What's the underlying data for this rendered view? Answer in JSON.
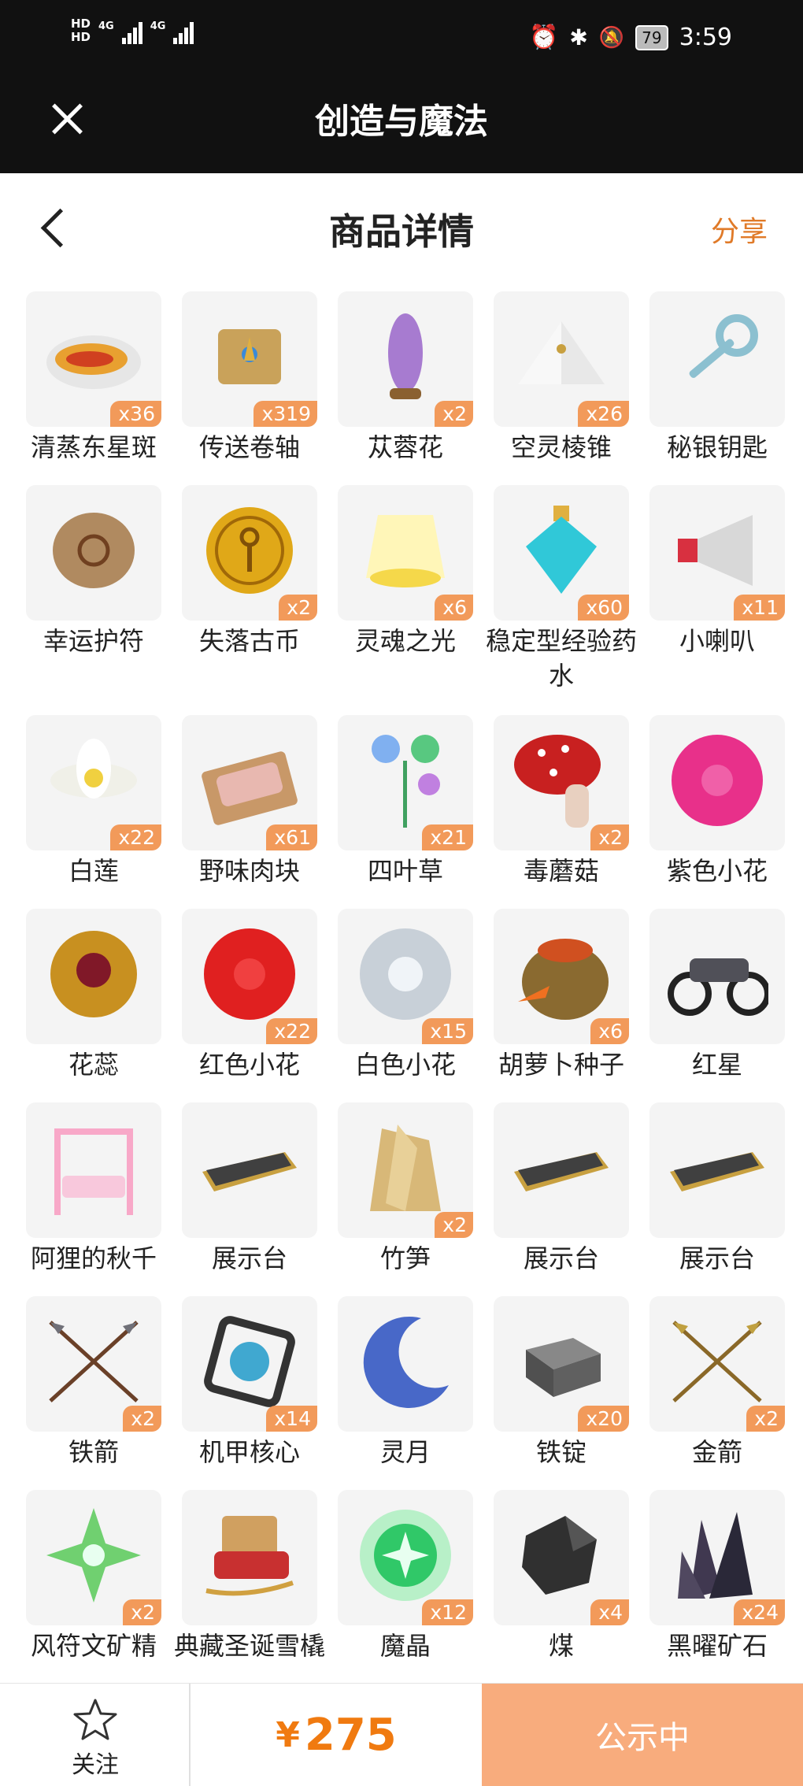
{
  "status_bar": {
    "hd1": "HD",
    "hd2": "HD",
    "net1": "4G",
    "net2": "4G",
    "battery": "79",
    "time": "3:59"
  },
  "app": {
    "title": "创造与魔法"
  },
  "header": {
    "title": "商品详情",
    "share_label": "分享"
  },
  "items": [
    {
      "name": "清蒸东星斑",
      "qty": "x36",
      "icon": "fish-dish-icon",
      "color": "#e8a030"
    },
    {
      "name": "传送卷轴",
      "qty": "x319",
      "icon": "scroll-icon",
      "color": "#c9a25a"
    },
    {
      "name": "苁蓉花",
      "qty": "x2",
      "icon": "cistanche-flower-icon",
      "color": "#a77bd0"
    },
    {
      "name": "空灵棱锥",
      "qty": "x26",
      "icon": "pyramid-icon",
      "color": "#e8e8e8"
    },
    {
      "name": "秘银钥匙",
      "qty": "",
      "icon": "key-icon",
      "color": "#8cc0d0"
    },
    {
      "name": "幸运护符",
      "qty": "",
      "icon": "amulet-icon",
      "color": "#b08a60"
    },
    {
      "name": "失落古币",
      "qty": "x2",
      "icon": "coin-icon",
      "color": "#e0a818"
    },
    {
      "name": "灵魂之光",
      "qty": "x6",
      "icon": "light-icon",
      "color": "#f5d84a"
    },
    {
      "name": "稳定型经验药水",
      "qty": "x60",
      "icon": "potion-icon",
      "color": "#30c8d8"
    },
    {
      "name": "小喇叭",
      "qty": "x11",
      "icon": "megaphone-icon",
      "color": "#d83040"
    },
    {
      "name": "白莲",
      "qty": "x22",
      "icon": "lotus-icon",
      "color": "#f0f0e8"
    },
    {
      "name": "野味肉块",
      "qty": "x61",
      "icon": "meat-icon",
      "color": "#b07858"
    },
    {
      "name": "四叶草",
      "qty": "x21",
      "icon": "clover-icon",
      "color": "#58c880"
    },
    {
      "name": "毒蘑菇",
      "qty": "x2",
      "icon": "mushroom-icon",
      "color": "#c82020"
    },
    {
      "name": "紫色小花",
      "qty": "",
      "icon": "purple-flower-icon",
      "color": "#e8308a"
    },
    {
      "name": "花蕊",
      "qty": "",
      "icon": "stamen-icon",
      "color": "#c89020"
    },
    {
      "name": "红色小花",
      "qty": "x22",
      "icon": "red-flower-icon",
      "color": "#e02020"
    },
    {
      "name": "白色小花",
      "qty": "x15",
      "icon": "white-flower-icon",
      "color": "#c8d0d8"
    },
    {
      "name": "胡萝卜种子",
      "qty": "x6",
      "icon": "seed-bag-icon",
      "color": "#8a6a30"
    },
    {
      "name": "红星",
      "qty": "",
      "icon": "motorcycle-icon",
      "color": "#505058"
    },
    {
      "name": "阿狸的秋千",
      "qty": "",
      "icon": "swing-icon",
      "color": "#f8a8c8"
    },
    {
      "name": "展示台",
      "qty": "",
      "icon": "display-stand-icon",
      "color": "#404040"
    },
    {
      "name": "竹笋",
      "qty": "x2",
      "icon": "bamboo-shoot-icon",
      "color": "#d8b878"
    },
    {
      "name": "展示台",
      "qty": "",
      "icon": "display-stand-icon",
      "color": "#404040"
    },
    {
      "name": "展示台",
      "qty": "",
      "icon": "display-stand-icon",
      "color": "#404040"
    },
    {
      "name": "铁箭",
      "qty": "x2",
      "icon": "iron-arrow-icon",
      "color": "#707078"
    },
    {
      "name": "机甲核心",
      "qty": "x14",
      "icon": "mech-core-icon",
      "color": "#40a8d0"
    },
    {
      "name": "灵月",
      "qty": "",
      "icon": "moon-icon",
      "color": "#4868c8"
    },
    {
      "name": "铁锭",
      "qty": "x20",
      "icon": "iron-ingot-icon",
      "color": "#606060"
    },
    {
      "name": "金箭",
      "qty": "x2",
      "icon": "gold-arrow-icon",
      "color": "#c0a040"
    },
    {
      "name": "风符文矿精",
      "qty": "x2",
      "icon": "wind-rune-icon",
      "color": "#70d070"
    },
    {
      "name": "典藏圣诞雪橇",
      "qty": "",
      "icon": "sleigh-icon",
      "color": "#c83030"
    },
    {
      "name": "魔晶",
      "qty": "x12",
      "icon": "magic-crystal-icon",
      "color": "#30c868"
    },
    {
      "name": "煤",
      "qty": "x4",
      "icon": "coal-icon",
      "color": "#303030"
    },
    {
      "name": "黑曜矿石",
      "qty": "x24",
      "icon": "obsidian-icon",
      "color": "#403850"
    }
  ],
  "bottom": {
    "follow_label": "关注",
    "currency": "¥",
    "price": "275",
    "status_label": "公示中"
  }
}
